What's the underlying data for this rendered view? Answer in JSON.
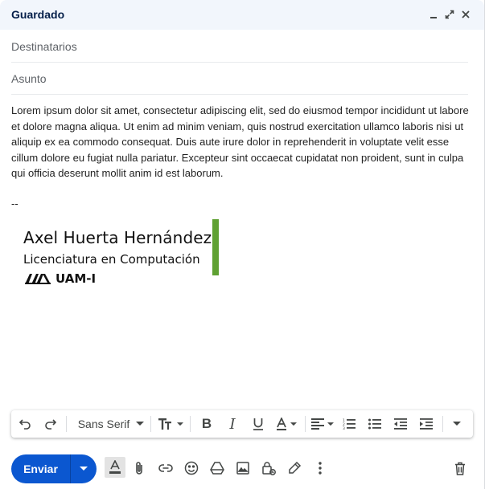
{
  "header": {
    "title": "Guardado",
    "icons": [
      "minimize-icon",
      "expand-icon",
      "close-icon"
    ]
  },
  "fields": {
    "to_placeholder": "Destinatarios",
    "subject_placeholder": "Asunto"
  },
  "body": {
    "text": "Lorem ipsum dolor sit amet, consectetur adipiscing elit, sed do eiusmod tempor incididunt ut labore et dolore magna aliqua. Ut enim ad minim veniam, quis nostrud exercitation ullamco laboris nisi ut aliquip ex ea commodo consequat. Duis aute irure dolor in reprehenderit in voluptate velit esse cillum dolore eu fugiat nulla pariatur. Excepteur sint occaecat cupidatat non proident, sunt in culpa qui officia deserunt mollit anim id est laborum.",
    "signature_separator": "--"
  },
  "signature": {
    "name": "Axel Huerta Hernández",
    "role": "Licenciatura en Computación",
    "institution": "UAM-I",
    "bar_color": "#5fa132"
  },
  "toolbar": {
    "font": "Sans Serif",
    "icons": [
      "undo-icon",
      "redo-icon",
      "font-size-icon",
      "bold-icon",
      "italic-icon",
      "underline-icon",
      "text-color-icon",
      "align-icon",
      "numbered-list-icon",
      "bulleted-list-icon",
      "indent-less-icon",
      "indent-more-icon",
      "more-formatting-icon"
    ]
  },
  "bottom": {
    "send_label": "Enviar",
    "accent": "#0b57d0",
    "icons": [
      "formatting-options-icon",
      "attach-icon",
      "link-icon",
      "emoji-icon",
      "drive-icon",
      "photo-icon",
      "confidential-mode-icon",
      "signature-icon",
      "more-options-icon",
      "discard-icon"
    ]
  }
}
